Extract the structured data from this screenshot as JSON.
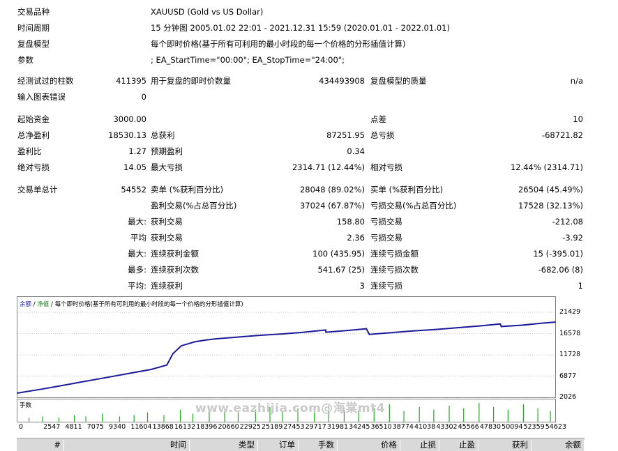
{
  "settings": {
    "symbol_label": "交易品种",
    "symbol_value": "XAUUSD (Gold vs US Dollar)",
    "period_label": "时间周期",
    "period_value": "15 分钟图 2005.01.02 22:01 - 2021.12.31 15:59 (2020.01.01 - 2022.01.01)",
    "model_label": "复盘模型",
    "model_value": "每个即时价格(基于所有可利用的最小时段的每一个价格的分形插值计算)",
    "params_label": "参数",
    "params_value": "; EA_StartTime=\"00:00\"; EA_StopTime=\"24:00\";"
  },
  "stats": {
    "bars_label": "经测试过的柱数",
    "bars_value": "411395",
    "ticks_label": "用于复盘的即时价数量",
    "ticks_value": "434493908",
    "quality_label": "复盘模型的质量",
    "quality_value": "n/a",
    "errors_label": "输入图表错误",
    "errors_value": "0",
    "deposit_label": "起始资金",
    "deposit_value": "3000.00",
    "spread_label": "点差",
    "spread_value": "10",
    "net_label": "总净盈利",
    "net_value": "18530.13",
    "gross_profit_label": "总获利",
    "gross_profit_value": "87251.95",
    "gross_loss_label": "总亏损",
    "gross_loss_value": "-68721.82",
    "pf_label": "盈利比",
    "pf_value": "1.27",
    "payoff_label": "预期盈利",
    "payoff_value": "0.34",
    "abs_dd_label": "绝对亏损",
    "abs_dd_value": "14.05",
    "max_dd_label": "最大亏损",
    "max_dd_value": "2314.71 (12.44%)",
    "rel_dd_label": "相对亏损",
    "rel_dd_value": "12.44% (2314.71)",
    "total_trades_label": "交易单总计",
    "total_trades_value": "54552",
    "short_label": "卖单 (%获利百分比)",
    "short_value": "28048 (89.02%)",
    "long_label": "买单 (%获利百分比)",
    "long_value": "26504 (45.49%)",
    "profit_trades_label": "盈利交易(%占总百分比)",
    "profit_trades_value": "37024 (67.87%)",
    "loss_trades_label": "亏损交易(%占总百分比)",
    "loss_trades_value": "17528 (32.13%)",
    "max_prefix": "最大:",
    "max_profit_label": "获利交易",
    "max_profit_value": "158.80",
    "max_loss_label": "亏损交易",
    "max_loss_value": "-212.08",
    "avg_prefix": "平均",
    "avg_profit_label": "获利交易",
    "avg_profit_value": "2.36",
    "avg_loss_label": "亏损交易",
    "avg_loss_value": "-3.92",
    "maxc_prefix": "最大:",
    "maxc_wins_label": "连续获利金额",
    "maxc_wins_value": "100 (435.95)",
    "maxc_losses_label": "连续亏损金额",
    "maxc_losses_value": "15 (-395.01)",
    "most_prefix": "最多:",
    "most_wins_label": "连续获利次数",
    "most_wins_value": "541.67 (25)",
    "most_losses_label": "连续亏损次数",
    "most_losses_value": "-682.06 (8)",
    "avgc_prefix": "平均:",
    "avgc_wins_label": "连续获利",
    "avgc_wins_value": "3",
    "avgc_losses_label": "连续亏损",
    "avgc_losses_value": "1"
  },
  "chart_legend": {
    "balance": "余额",
    "sep1": " / ",
    "equity": "净值",
    "sep2": " / ",
    "model": "每个即时价格(基于所有可利用的最小时段的每一个价格的分形插值计算)"
  },
  "volume_label": "手数",
  "watermark": "www.eazhijia.com@海棠mt4",
  "chart_data": {
    "type": "line",
    "colors": {
      "balance": "#1a1a9a",
      "volume": "#22aa22",
      "grid": "#c8c8c8"
    },
    "ylim": [
      2026,
      24000
    ],
    "yticks": [
      2026,
      6877,
      11728,
      16578,
      21429
    ],
    "x_ticks": [
      "0",
      "2547",
      "4811",
      "7075",
      "9340",
      "11604",
      "13868",
      "16132",
      "18396",
      "20660",
      "22925",
      "25189",
      "27453",
      "29717",
      "31981",
      "34245",
      "36510",
      "38774",
      "41038",
      "43302",
      "45566",
      "47830",
      "50094",
      "52359",
      "54623"
    ],
    "xlim": [
      0,
      55800
    ],
    "series": [
      {
        "x": [
          0,
          2547,
          4811,
          7075,
          9340,
          11604,
          13868,
          15500,
          16132,
          17000,
          18396,
          19500,
          20660,
          22925,
          25189,
          27453,
          29717,
          31981,
          32000,
          34245,
          36200,
          36510,
          38774,
          41038,
          43302,
          45566,
          47830,
          50094,
          50200,
          52359,
          54623,
          55800
        ],
        "values": [
          3000,
          3900,
          4800,
          5700,
          6600,
          7500,
          8400,
          9400,
          12000,
          13800,
          14700,
          15100,
          15400,
          15800,
          16200,
          16500,
          16900,
          17400,
          16900,
          17300,
          17700,
          16400,
          16800,
          17200,
          17500,
          17900,
          18300,
          18800,
          18200,
          18500,
          19000,
          19200
        ]
      }
    ],
    "volume": {
      "x": [
        1200,
        2600,
        4300,
        5900,
        7100,
        8800,
        10600,
        12100,
        13500,
        15200,
        16900,
        18200,
        19900,
        21500,
        22900,
        24700,
        26200,
        27500,
        29100,
        30800,
        32300,
        33900,
        35400,
        37000,
        38600,
        40100,
        41700,
        43200,
        44800,
        46300,
        47900,
        49400,
        50900,
        52500,
        54000,
        55300
      ],
      "values": [
        3,
        4,
        3,
        5,
        4,
        6,
        4,
        5,
        7,
        5,
        9,
        6,
        10,
        8,
        7,
        9,
        11,
        8,
        10,
        7,
        12,
        9,
        8,
        10,
        13,
        8,
        11,
        9,
        12,
        10,
        14,
        11,
        9,
        13,
        10,
        8
      ]
    }
  },
  "table_header": [
    "#",
    "时间",
    "类型",
    "订单",
    "手数",
    "价格",
    "止损",
    "止盈",
    "获利",
    "余额"
  ]
}
